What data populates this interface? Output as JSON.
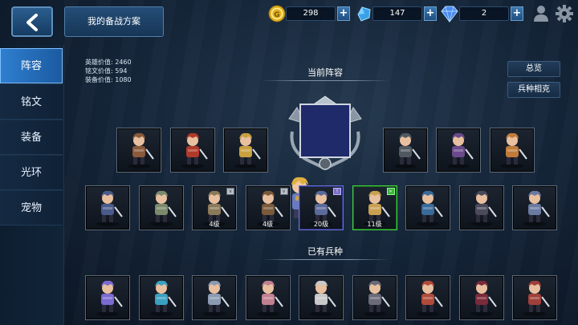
{
  "topbar": {
    "plan_button": "我的备战方案",
    "gold": {
      "value": "298",
      "icon": "gold-coin-icon"
    },
    "crystal": {
      "value": "147",
      "icon": "blue-crystal-icon"
    },
    "diamond": {
      "value": "2",
      "icon": "diamond-icon"
    },
    "plus_label": "+"
  },
  "sidebar": {
    "items": [
      {
        "label": "阵容",
        "active": true
      },
      {
        "label": "铭文",
        "active": false
      },
      {
        "label": "装备",
        "active": false
      },
      {
        "label": "光环",
        "active": false
      },
      {
        "label": "宠物",
        "active": false
      }
    ]
  },
  "stats": {
    "hero_value": "英雄价值: 2460",
    "inscription_value": "铭文价值: 594",
    "equipment_value": "装备价值: 1080"
  },
  "buttons": {
    "overview": "总览",
    "counter": "兵种相克"
  },
  "sections": {
    "current_lineup": "当前阵容",
    "owned_units": "已有兵种"
  },
  "lineup_row1": [
    {
      "name": "unit-swordsman-brown",
      "color": "#8a5a3a"
    },
    {
      "name": "unit-red-knight",
      "color": "#b03a2a"
    },
    {
      "name": "unit-blonde-warrior",
      "color": "#c8a040"
    },
    {
      "name": "unit-ninja-black",
      "color": "#505860"
    },
    {
      "name": "unit-purple-brute",
      "color": "#6a4a8a"
    },
    {
      "name": "unit-fox-archer",
      "color": "#c07a3a"
    }
  ],
  "lineup_row2": [
    {
      "name": "unit-crossbowman",
      "color": "#4a5a8a",
      "level": "",
      "frame": "none",
      "badge": ""
    },
    {
      "name": "unit-shield-guard",
      "color": "#7a8a6a",
      "level": "",
      "frame": "none",
      "badge": ""
    },
    {
      "name": "unit-cavalry-knight",
      "color": "#8a7a5a",
      "level": "4级",
      "frame": "gray",
      "badge": "v"
    },
    {
      "name": "unit-viking-rider",
      "color": "#7a5a3a",
      "level": "4级",
      "frame": "gray",
      "badge": "v"
    },
    {
      "name": "unit-armored-soldier",
      "color": "#5a6a9a",
      "level": "20级",
      "frame": "blue",
      "badge": "!"
    },
    {
      "name": "unit-golden-swordsman",
      "color": "#c8a050",
      "level": "11级",
      "frame": "green",
      "badge": "»"
    },
    {
      "name": "unit-dragon-rider",
      "color": "#3a6a9a",
      "level": "",
      "frame": "none",
      "badge": ""
    },
    {
      "name": "unit-dark-golem",
      "color": "#4a4a5a",
      "level": "",
      "frame": "none",
      "badge": ""
    },
    {
      "name": "unit-gunner",
      "color": "#6a7aa0",
      "level": "",
      "frame": "none",
      "badge": ""
    }
  ],
  "owned_row": [
    {
      "name": "unit-crystal-mage",
      "color": "#7a6ad0"
    },
    {
      "name": "unit-cyan-sorceress",
      "color": "#3aa0c0"
    },
    {
      "name": "unit-silver-knight",
      "color": "#8a9ab0"
    },
    {
      "name": "unit-pink-golem",
      "color": "#c08090"
    },
    {
      "name": "unit-white-priest",
      "color": "#c8c8c8"
    },
    {
      "name": "unit-gray-armor",
      "color": "#6a6a78"
    },
    {
      "name": "unit-red-brawler",
      "color": "#b04a3a"
    },
    {
      "name": "unit-vampire",
      "color": "#7a2a3a"
    },
    {
      "name": "unit-red-paladin",
      "color": "#a0403a"
    }
  ],
  "leader": {
    "name": "leader-hero-portrait",
    "color": "#c8a040"
  }
}
